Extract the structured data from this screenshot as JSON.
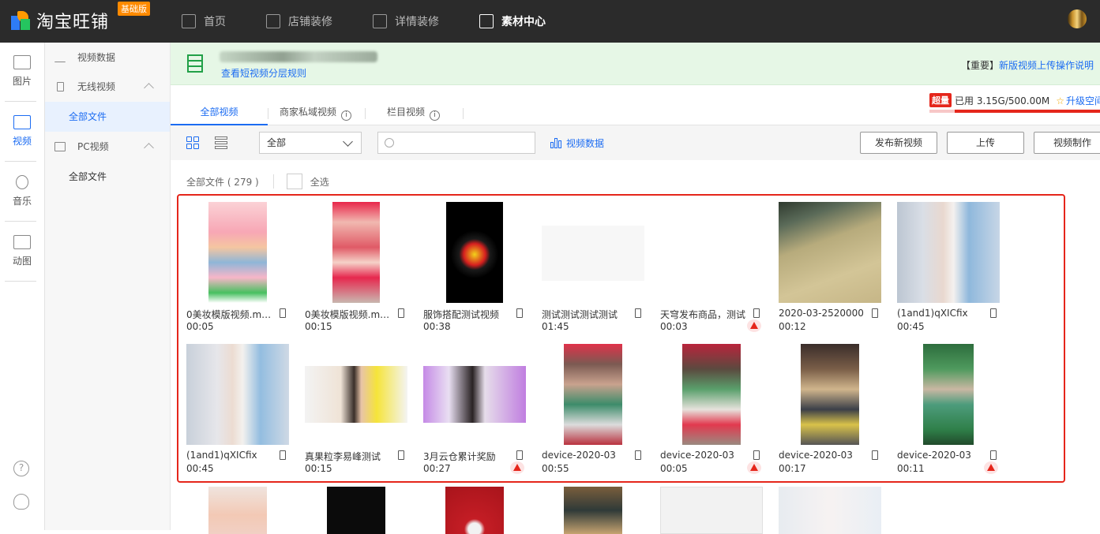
{
  "header": {
    "logo_text": "淘宝旺铺",
    "edition_badge": "基础版",
    "nav": [
      {
        "label": "首页",
        "icon": "home-icon"
      },
      {
        "label": "店铺装修",
        "icon": "shop-icon"
      },
      {
        "label": "详情装修",
        "icon": "detail-icon"
      },
      {
        "label": "素材中心",
        "icon": "folder-icon",
        "active": true
      }
    ]
  },
  "rail": [
    {
      "label": "图片",
      "icon": "image-icon"
    },
    {
      "label": "视频",
      "icon": "video-icon",
      "active": true
    },
    {
      "label": "音乐",
      "icon": "music-icon"
    },
    {
      "label": "动图",
      "icon": "gif-icon"
    }
  ],
  "sidenav": {
    "video_data": "视频数据",
    "wireless": "无线视频",
    "wireless_all": "全部文件",
    "pc": "PC视频",
    "pc_all": "全部文件"
  },
  "notice": {
    "link": "查看短视频分层规则",
    "right_prefix": "【重要】",
    "right_link": "新版视频上传操作说明"
  },
  "storage": {
    "badge": "超量",
    "used": "已用 3.15G/500.00M",
    "upgrade": "升级空间",
    "usage_ratio": 0.85
  },
  "tabs": [
    {
      "label": "全部视频",
      "active": true
    },
    {
      "label": "商家私域视频",
      "info": "i"
    },
    {
      "label": "栏目视频",
      "info": "i"
    }
  ],
  "toolbar": {
    "select_value": "全部",
    "search_placeholder": "",
    "video_data": "视频数据",
    "buttons": [
      "发布新视频",
      "上传",
      "视频制作"
    ]
  },
  "files": {
    "summary": "全部文件 ( 279 )",
    "select_all": "全选"
  },
  "videos": [
    {
      "title": "0美妆模版视频.mp4",
      "duration": "00:05",
      "warn": false
    },
    {
      "title": "0美妆模版视频.mp4",
      "duration": "00:15",
      "warn": false
    },
    {
      "title": "服饰搭配测试视频",
      "duration": "00:38",
      "warn": false
    },
    {
      "title": "测试测试测试测试",
      "duration": "01:45",
      "warn": false
    },
    {
      "title": "天穹发布商品，测试",
      "duration": "00:03",
      "warn": true
    },
    {
      "title": "2020-03-2520000",
      "duration": "00:12",
      "warn": false
    },
    {
      "title": "(1and1)qXICfix",
      "duration": "00:45",
      "warn": false
    },
    {
      "title": "(1and1)qXICfix",
      "duration": "00:45",
      "warn": false
    },
    {
      "title": "真果粒李易峰测试",
      "duration": "00:15",
      "warn": false
    },
    {
      "title": "3月云仓累计奖励",
      "duration": "00:27",
      "warn": true
    },
    {
      "title": "device-2020-03",
      "duration": "00:55",
      "warn": false
    },
    {
      "title": "device-2020-03",
      "duration": "00:05",
      "warn": true
    },
    {
      "title": "device-2020-03",
      "duration": "00:17",
      "warn": false
    },
    {
      "title": "device-2020-03",
      "duration": "00:11",
      "warn": true
    }
  ],
  "colors": {
    "accent": "#1c6cf2",
    "danger": "#e5261b",
    "topbar": "#2b2b2b",
    "notice_bg": "#e6f7e6"
  }
}
